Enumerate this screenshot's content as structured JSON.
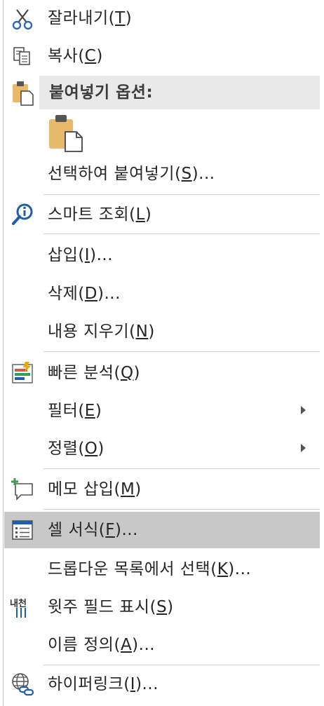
{
  "menu": {
    "cut": {
      "label": "잘라내기(",
      "key": "T",
      "tail": ")"
    },
    "copy": {
      "label": "복사(",
      "key": "C",
      "tail": ")"
    },
    "paste_options_header": "붙여넣기 옵션:",
    "paste_special": {
      "label": "선택하여 붙여넣기(",
      "key": "S",
      "tail": ")..."
    },
    "smart_lookup": {
      "label": "스마트 조회(",
      "key": "L",
      "tail": ")"
    },
    "insert": {
      "label": "삽입(",
      "key": "I",
      "tail": ")..."
    },
    "delete": {
      "label": "삭제(",
      "key": "D",
      "tail": ")..."
    },
    "clear_contents": {
      "label": "내용 지우기(",
      "key": "N",
      "tail": ")"
    },
    "quick_analysis": {
      "label": "빠른 분석(",
      "key": "Q",
      "tail": ")"
    },
    "filter": {
      "label": "필터(",
      "key": "E",
      "tail": ")"
    },
    "sort": {
      "label": "정렬(",
      "key": "O",
      "tail": ")"
    },
    "insert_note": {
      "label": "메모 삽입(",
      "key": "M",
      "tail": ")"
    },
    "format_cells": {
      "label": "셀 서식(",
      "key": "F",
      "tail": ")..."
    },
    "pick_from_list": {
      "label": "드롭다운 목록에서 선택(",
      "key": "K",
      "tail": ")..."
    },
    "phonetic": {
      "label": "윗주 필드 표시(",
      "key": "S",
      "tail": ")"
    },
    "define_name": {
      "label": "이름 정의(",
      "key": "A",
      "tail": ")..."
    },
    "hyperlink": {
      "label": "하이퍼링크(",
      "key": "I",
      "tail": ")..."
    },
    "phonetic_icon_text": "내천"
  },
  "colors": {
    "hover": "#c8c8c8",
    "header_bg": "#e9e9e9",
    "clipboard": "#e8b86b",
    "accent_blue": "#1f5fa8",
    "accent_green": "#3a9b52"
  }
}
